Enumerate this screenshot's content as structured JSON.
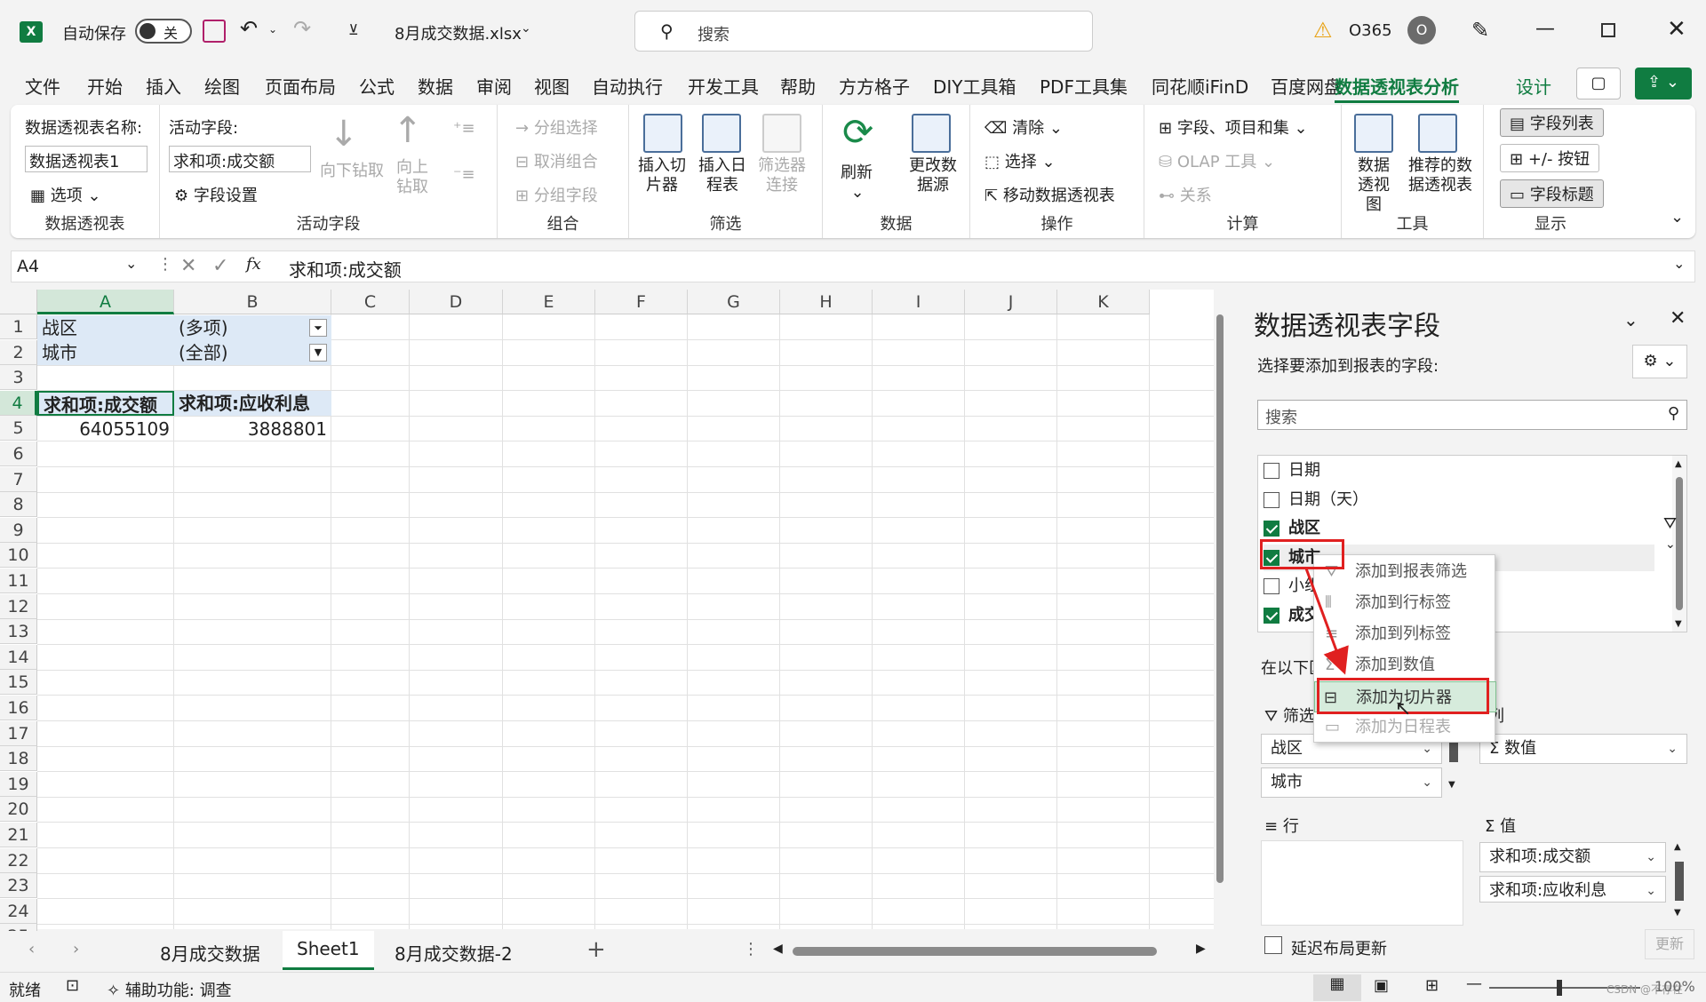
{
  "titlebar": {
    "autosave": "自动保存",
    "toggle": "关",
    "filename": "8月成交数据.xlsx",
    "search": "搜索",
    "account": "O365",
    "avatar": "O"
  },
  "menu": [
    "文件",
    "开始",
    "插入",
    "绘图",
    "页面布局",
    "公式",
    "数据",
    "审阅",
    "视图",
    "自动执行",
    "开发工具",
    "帮助",
    "方方格子",
    "DIY工具箱",
    "PDF工具集",
    "同花顺iFinD",
    "百度网盘",
    "数据透视表分析",
    "设计"
  ],
  "ribbon": {
    "pt_name_label": "数据透视表名称:",
    "pt_name": "数据透视表1",
    "options": "选项",
    "group1": "数据透视表",
    "active_field_label": "活动字段:",
    "active_field": "求和项:成交额",
    "drill_down": "向下钻取",
    "drill_up": "向上钻取",
    "field_settings": "字段设置",
    "group2": "活动字段",
    "group_sel": "分组选择",
    "ungroup": "取消组合",
    "group_field": "分组字段",
    "group3": "组合",
    "insert_slicer": "插入切片器",
    "insert_timeline": "插入日程表",
    "filter_conn": "筛选器连接",
    "group4": "筛选",
    "refresh": "刷新",
    "change_source": "更改数据源",
    "group5": "数据",
    "clear": "清除",
    "select": "选择",
    "move_pt": "移动数据透视表",
    "group6": "操作",
    "fields_items": "字段、项目和集",
    "olap": "OLAP 工具",
    "relations": "关系",
    "group7": "计算",
    "pivot_chart": "数据透视图",
    "recommended": "推荐的数据透视表",
    "group8": "工具",
    "field_list": "字段列表",
    "pm_buttons": "+/- 按钮",
    "field_headers": "字段标题",
    "group9": "显示"
  },
  "formula": {
    "namebox": "A4",
    "fx": "fx",
    "content": "求和项:成交额"
  },
  "grid": {
    "columns": [
      "A",
      "B",
      "C",
      "D",
      "E",
      "F",
      "G",
      "H",
      "I",
      "J",
      "K"
    ],
    "rows": [
      "1",
      "2",
      "3",
      "4",
      "5",
      "6",
      "7",
      "8",
      "9",
      "10",
      "11",
      "12",
      "13",
      "14",
      "15",
      "16",
      "17",
      "18",
      "19",
      "20",
      "21",
      "22",
      "23",
      "24",
      "25"
    ],
    "a1": "战区",
    "b1": "(多项)",
    "a2": "城市",
    "b2": "(全部)",
    "a4": "求和项:成交额",
    "b4": "求和项:应收利息",
    "a5": "64055109",
    "b5": "3888801"
  },
  "tabs": [
    "8月成交数据",
    "Sheet1",
    "8月成交数据-2"
  ],
  "pane": {
    "title": "数据透视表字段",
    "subtitle": "选择要添加到报表的字段:",
    "search": "搜索",
    "fields": [
      {
        "label": "日期",
        "checked": false
      },
      {
        "label": "日期（天）",
        "checked": false
      },
      {
        "label": "战区",
        "checked": true
      },
      {
        "label": "城市",
        "checked": true
      },
      {
        "label": "小组",
        "checked": false
      },
      {
        "label": "成交额",
        "checked": true
      }
    ],
    "drag_label": "在以下区域间拖动字段:",
    "filters_label": "筛选",
    "columns_label": "列",
    "rows_label": "行",
    "values_label": "值",
    "filter_items": [
      "战区",
      "城市"
    ],
    "column_items": [
      "Σ 数值"
    ],
    "value_items": [
      "求和项:成交额",
      "求和项:应收利息"
    ],
    "defer": "延迟布局更新",
    "update": "更新"
  },
  "context_menu": [
    "添加到报表筛选",
    "添加到行标签",
    "添加到列标签",
    "添加到数值",
    "添加为切片器",
    "添加为日程表"
  ],
  "status": {
    "ready": "就绪",
    "accessibility": "辅助功能: 调查",
    "zoom": "100%",
    "watermark": "CSDN @不存在"
  }
}
